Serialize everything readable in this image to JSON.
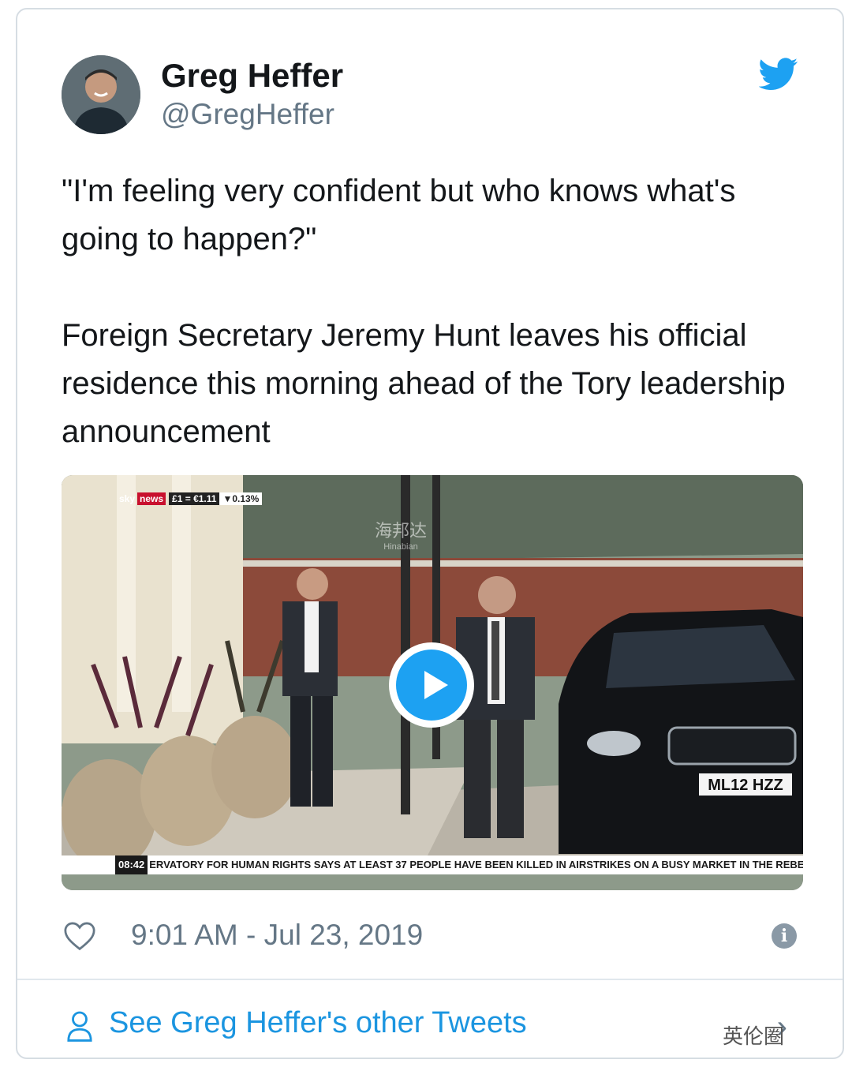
{
  "author": {
    "name": "Greg Heffer",
    "handle": "@GregHeffer"
  },
  "tweet": {
    "paragraphs": [
      "\"I'm feeling very confident but who knows what's going to happen?\"",
      "Foreign Secretary Jeremy Hunt leaves his official residence this morning ahead of the Tory leadership announcement"
    ]
  },
  "media": {
    "channel_brand": "sky",
    "channel_news": "news",
    "fx_rate": "£1 = €1.11",
    "fx_change": "▼0.13%",
    "watermark": "海邦达",
    "watermark_latin": "Hinabian",
    "plate": "ML12 HZZ",
    "ticker_time": "08:42",
    "ticker_text": "ERVATORY FOR HUMAN RIGHTS SAYS AT LEAST 37 PEOPLE HAVE BEEN KILLED IN AIRSTRIKES ON A BUSY MARKET IN THE REBEL-"
  },
  "meta": {
    "timestamp": "9:01 AM - Jul 23, 2019",
    "info_glyph": "i"
  },
  "footer": {
    "link_text": "See Greg Heffer's other Tweets",
    "chevron": "›",
    "watermark": "英伦圈"
  },
  "colors": {
    "twitter_blue": "#1da1f2",
    "link_blue": "#1b95e0",
    "secondary_text": "#657786",
    "border": "#d6dde3"
  }
}
